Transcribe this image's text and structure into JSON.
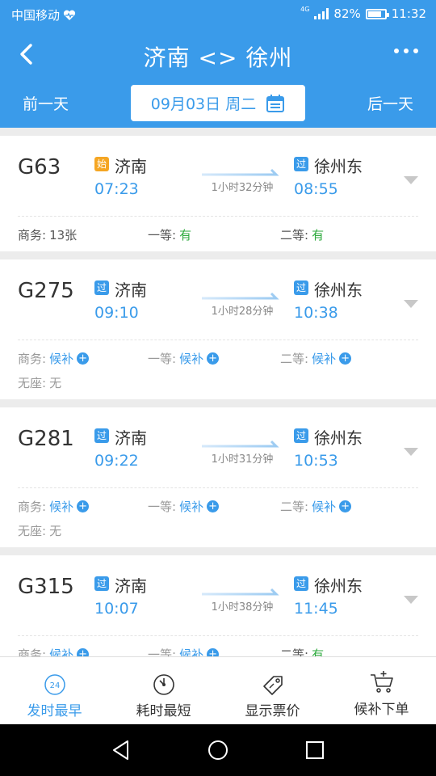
{
  "status_bar": {
    "carrier": "中国移动",
    "network": "4G",
    "battery": "82%",
    "battery_level": 0.82,
    "time": "11:32"
  },
  "header": {
    "title": "济南 <> 徐州",
    "prev_day": "前一天",
    "next_day": "后一天",
    "date": "09月03日 周二"
  },
  "trains": [
    {
      "number": "G63",
      "dep_badge": "始",
      "dep_badge_type": "start",
      "dep_station": "济南",
      "dep_time": "07:23",
      "duration": "1小时32分钟",
      "arr_badge": "过",
      "arr_station": "徐州东",
      "arr_time": "08:55",
      "seats": [
        {
          "label": "商务:",
          "value": "13张"
        },
        {
          "label": "一等:",
          "value": "有"
        },
        {
          "label": "二等:",
          "value": "有"
        }
      ]
    },
    {
      "number": "G275",
      "dep_badge": "过",
      "dep_badge_type": "pass",
      "dep_station": "济南",
      "dep_time": "09:10",
      "duration": "1小时28分钟",
      "arr_badge": "过",
      "arr_station": "徐州东",
      "arr_time": "10:38",
      "seats": [
        {
          "label": "商务:",
          "value": "候补"
        },
        {
          "label": "一等:",
          "value": "候补"
        },
        {
          "label": "二等:",
          "value": "候补"
        },
        {
          "label": "无座:",
          "value": "无"
        }
      ]
    },
    {
      "number": "G281",
      "dep_badge": "过",
      "dep_badge_type": "pass",
      "dep_station": "济南",
      "dep_time": "09:22",
      "duration": "1小时31分钟",
      "arr_badge": "过",
      "arr_station": "徐州东",
      "arr_time": "10:53",
      "seats": [
        {
          "label": "商务:",
          "value": "候补"
        },
        {
          "label": "一等:",
          "value": "候补"
        },
        {
          "label": "二等:",
          "value": "候补"
        },
        {
          "label": "无座:",
          "value": "无"
        }
      ]
    },
    {
      "number": "G315",
      "dep_badge": "过",
      "dep_badge_type": "pass",
      "dep_station": "济南",
      "dep_time": "10:07",
      "duration": "1小时38分钟",
      "arr_badge": "过",
      "arr_station": "徐州东",
      "arr_time": "11:45",
      "seats": [
        {
          "label": "商务:",
          "value": "候补"
        },
        {
          "label": "一等:",
          "value": "候补"
        },
        {
          "label": "二等:",
          "value": "有"
        }
      ]
    }
  ],
  "toolbar": {
    "clock_icon_text": "24",
    "items": [
      {
        "label": "发时最早",
        "icon": "clock-24-icon"
      },
      {
        "label": "耗时最短",
        "icon": "timer-icon"
      },
      {
        "label": "显示票价",
        "icon": "price-tag-icon"
      },
      {
        "label": "候补下单",
        "icon": "cart-add-icon"
      }
    ]
  },
  "colors": {
    "primary": "#3a9bea",
    "available": "#2eaa3e",
    "start_badge": "#f5a623"
  }
}
